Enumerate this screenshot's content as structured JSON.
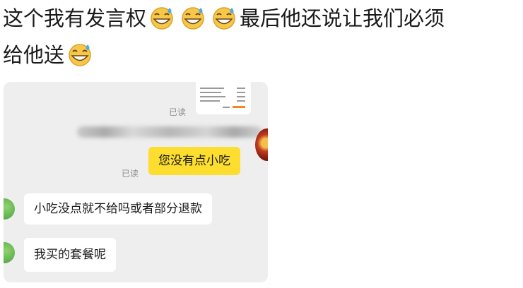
{
  "post": {
    "line1_text": "这个我有发言权",
    "line1_text_after": "最后他还说让我们必须",
    "line2_text": "给他送",
    "emoji_icon": "sweat-smile-emoji"
  },
  "chat": {
    "read_receipt_1": "已读",
    "read_receipt_2": "已读",
    "my_message": "您没有点小吃",
    "their_messages": [
      "小吃没点就不给吗或者部分退款",
      "我买的套餐呢"
    ]
  },
  "colors": {
    "my_bubble": "#fddd2e",
    "their_bubble": "#ffffff",
    "chat_background": "#eeeeef"
  }
}
